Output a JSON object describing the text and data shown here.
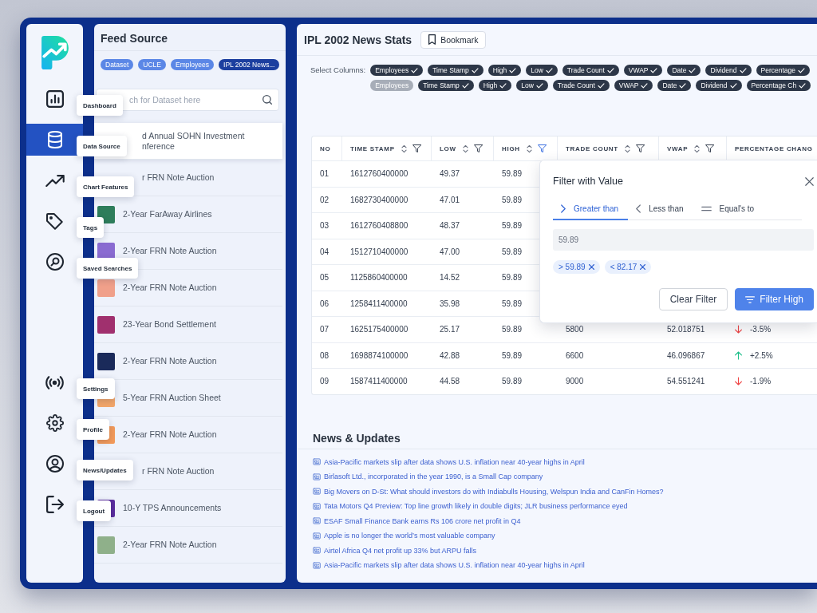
{
  "nav": {
    "top_items": [
      {
        "label": "Dashboard",
        "selected": false
      },
      {
        "label": "Data Source",
        "selected": true
      },
      {
        "label": "Chart Features",
        "selected": false
      },
      {
        "label": "Tags",
        "selected": false
      },
      {
        "label": "Saved Searches",
        "selected": false
      }
    ],
    "bottom_items": [
      {
        "label": "Settings",
        "selected": false
      },
      {
        "label": "Profile",
        "selected": false
      },
      {
        "label": "News/Updates",
        "selected": false
      },
      {
        "label": "Logout",
        "selected": false
      }
    ]
  },
  "feed": {
    "title": "Feed Source",
    "tags": [
      {
        "label": "Dataset",
        "selected": false
      },
      {
        "label": "UCLE",
        "selected": false
      },
      {
        "label": "Employees",
        "selected": false
      },
      {
        "label": "IPL 2002 News...",
        "selected": true
      }
    ],
    "search": {
      "placeholder": "ch for Dataset here"
    },
    "items": [
      {
        "title": "d Annual SOHN Investment\nnference",
        "kind": "covered",
        "selected": true
      },
      {
        "title": "r FRN Note Auction",
        "kind": "covered",
        "selected": false
      },
      {
        "title": "2-Year FarAway Airlines",
        "kind": "thumb",
        "color": "#2e7d5b",
        "selected": false
      },
      {
        "title": "2-Year FRN Note Auction",
        "kind": "thumb",
        "color": "#8a6bd1",
        "selected": false
      },
      {
        "title": "2-Year FRN Note Auction",
        "kind": "thumb",
        "color": "#f0a08a",
        "selected": false
      },
      {
        "title": "23-Year Bond Settlement",
        "kind": "thumb",
        "color": "#a0306e",
        "selected": false
      },
      {
        "title": "2-Year FRN Note Auction",
        "kind": "thumb",
        "color": "#1a2a5a",
        "selected": false
      },
      {
        "title": "5-Year FRN Auction Sheet",
        "kind": "thumb",
        "color": "#f2a66a",
        "selected": false
      },
      {
        "title": "2-Year FRN Note Auction",
        "kind": "thumb",
        "color": "#f39a5a",
        "selected": false
      },
      {
        "title": "r FRN Note Auction",
        "kind": "covered",
        "selected": false
      },
      {
        "title": "10-Y TPS Announcements",
        "kind": "thumb",
        "color": "#5b2d9e",
        "selected": false
      },
      {
        "title": "2-Year FRN Note Auction",
        "kind": "thumb",
        "color": "#8fb08a",
        "selected": false
      }
    ]
  },
  "main": {
    "title": "IPL 2002 News Stats",
    "bookmark_button": {
      "label": "Bookmark"
    },
    "columns_picker": {
      "label": "Select Columns:",
      "rows": [
        [
          {
            "label": "Employees",
            "checked": true
          },
          {
            "label": "Time Stamp",
            "checked": true
          },
          {
            "label": "High",
            "checked": true
          },
          {
            "label": "Low",
            "checked": true
          },
          {
            "label": "Trade Count",
            "checked": true
          },
          {
            "label": "VWAP",
            "checked": true
          },
          {
            "label": "Date",
            "checked": true
          },
          {
            "label": "Dividend",
            "checked": true
          },
          {
            "label": "Percentage",
            "checked": true
          }
        ],
        [
          {
            "label": "Employees",
            "checked": false
          },
          {
            "label": "Time Stamp",
            "checked": true
          },
          {
            "label": "High",
            "checked": true
          },
          {
            "label": "Low",
            "checked": true
          },
          {
            "label": "Trade Count",
            "checked": true
          },
          {
            "label": "VWAP",
            "checked": true
          },
          {
            "label": "Date",
            "checked": true
          },
          {
            "label": "Dividend",
            "checked": true
          },
          {
            "label": "Percentage Ch",
            "checked": true
          }
        ]
      ]
    },
    "table": {
      "columns": [
        {
          "label": "NO",
          "kind": "plain"
        },
        {
          "label": "TIME STAMP",
          "kind": "sortable",
          "filtered": false
        },
        {
          "label": "LOW",
          "kind": "sortable",
          "filtered": false
        },
        {
          "label": "HIGH",
          "kind": "sortable",
          "filtered": true
        },
        {
          "label": "TRADE COUNT",
          "kind": "sortable",
          "filtered": false
        },
        {
          "label": "VWAP",
          "kind": "sortable",
          "filtered": false
        },
        {
          "label": "PERCENTAGE CHANG",
          "kind": "plain"
        }
      ],
      "rows": [
        {
          "cells": [
            "01",
            "1612760400000",
            "49.37",
            "59.89"
          ]
        },
        {
          "cells": [
            "02",
            "1682730400000",
            "47.01",
            "59.89"
          ]
        },
        {
          "cells": [
            "03",
            "1612760408800",
            "48.37",
            "59.89"
          ]
        },
        {
          "cells": [
            "04",
            "1512710400000",
            "47.00",
            "59.89"
          ]
        },
        {
          "cells": [
            "05",
            "1125860400000",
            "14.52",
            "59.89"
          ]
        },
        {
          "cells": [
            "06",
            "1258411400000",
            "35.98",
            "59.89"
          ]
        },
        {
          "cells": [
            "07",
            "1625175400000",
            "25.17",
            "59.89",
            "5800",
            "52.018751"
          ],
          "change": {
            "value": "-3.5%",
            "rising": false
          }
        },
        {
          "cells": [
            "08",
            "1698874100000",
            "42.88",
            "59.89",
            "6600",
            "46.096867"
          ],
          "change": {
            "value": "+2.5%",
            "rising": true
          }
        },
        {
          "cells": [
            "09",
            "1587411400000",
            "44.58",
            "59.89",
            "9000",
            "54.551241"
          ],
          "change": {
            "value": "-1.9%",
            "rising": false
          }
        }
      ]
    },
    "filter_popover": {
      "title": "Filter with Value",
      "tabs": [
        {
          "label": "Greater than",
          "kind": "greater",
          "selected": true
        },
        {
          "label": "Less than",
          "kind": "less",
          "selected": false
        },
        {
          "label": "Equal's to",
          "kind": "equal",
          "selected": false
        }
      ],
      "placeholder": "59.89",
      "chips": [
        "> 59.89",
        "< 82.17"
      ],
      "buttons": [
        {
          "label": "Clear Filter",
          "kind": "clear"
        },
        {
          "label": "Filter High",
          "kind": "apply"
        }
      ]
    },
    "news": {
      "title": "News & Updates",
      "items": [
        "Asia-Pacific markets slip after data shows U.S. inflation near 40-year highs in April",
        "Birlasoft Ltd., incorporated in the year 1990, is a Small Cap company",
        "Big Movers on D-St: What should investors do with Indiabulls Housing, Welspun India and CanFin Homes?",
        "Tata Motors Q4 Preview: Top line growth likely in double digits; JLR business performance eyed",
        "ESAF Small Finance Bank earns Rs 106 crore net profit in Q4",
        "Apple is no longer the world’s most valuable company",
        "Airtel Africa Q4 net profit up 33% but ARPU falls",
        "Asia-Pacific markets slip after data shows U.S. inflation near 40-year highs in April"
      ]
    }
  }
}
